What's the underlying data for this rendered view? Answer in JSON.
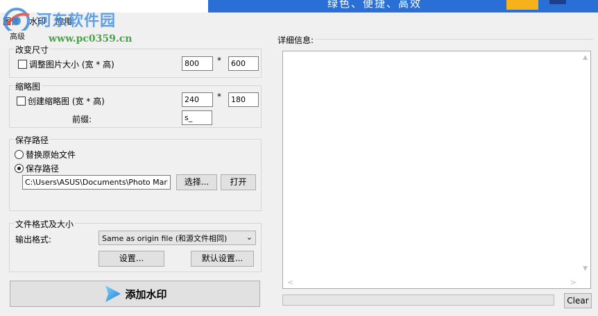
{
  "banner": {
    "slogan": "绿色、便捷、高效"
  },
  "watermark": {
    "title": "河东软件园",
    "url": "www.pc0359.cn"
  },
  "menu": {
    "items": [
      "图像",
      "水印",
      "应用"
    ]
  },
  "tab": {
    "label": "高级"
  },
  "resize": {
    "title": "改变尺寸",
    "checkbox_label": "调整图片大小 (宽 * 高)",
    "checked": false,
    "width": "800",
    "height": "600",
    "separator": "*"
  },
  "thumbnail": {
    "title": "缩略图",
    "checkbox_label": "创建缩略图 (宽 * 高)",
    "checked": false,
    "width": "240",
    "height": "180",
    "separator": "*",
    "prefix_label": "前缀:",
    "prefix_value": "s_"
  },
  "save_path": {
    "title": "保存路径",
    "option_replace": "替换原始文件",
    "option_path": "保存路径",
    "selected": "保存路径",
    "path_value": "C:\\Users\\ASUS\\Documents\\Photo Mark",
    "choose_label": "选择...",
    "open_label": "打开"
  },
  "format": {
    "title": "文件格式及大小",
    "output_label": "输出格式:",
    "output_value": "Same as origin file (和源文件相同)",
    "settings_label": "设置...",
    "default_label": "默认设置..."
  },
  "actions": {
    "add_watermark": "添加水印",
    "clear": "Clear"
  },
  "details": {
    "label": "详细信息:",
    "text": "",
    "progress": 0
  },
  "colors": {
    "banner_blue": "#2a6fd6",
    "watermark_blue": "#3d8be0",
    "watermark_green": "#3a9a3a"
  }
}
